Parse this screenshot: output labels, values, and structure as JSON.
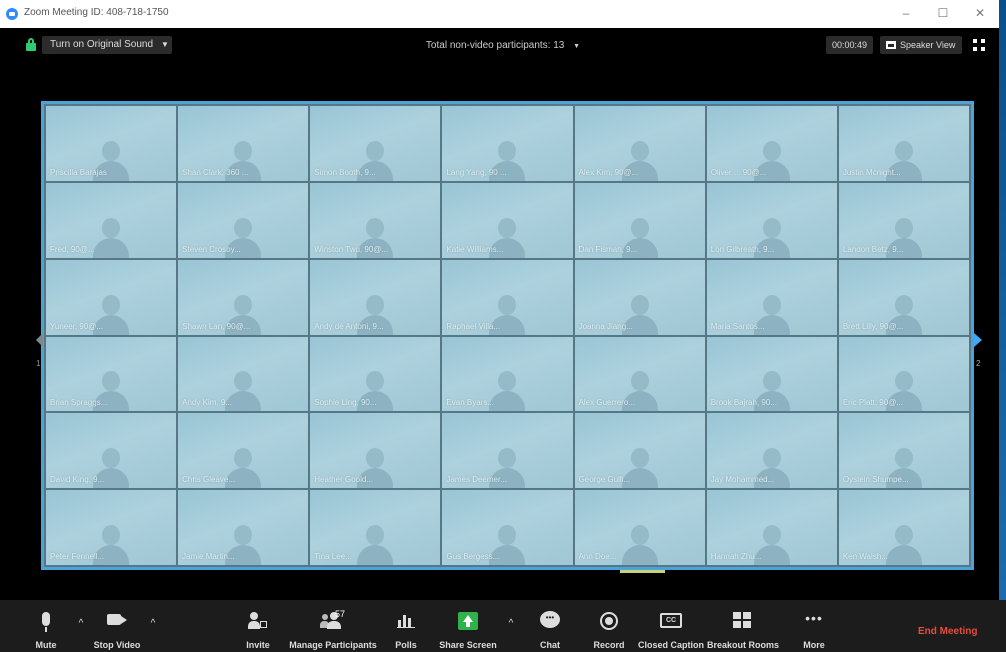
{
  "window": {
    "title": "Zoom Meeting ID: 408-718-1750",
    "minimize": "–",
    "maximize": "☐",
    "close": "✕"
  },
  "topbar": {
    "original_sound_label": "Turn on Original Sound",
    "original_sound_caret": "▼",
    "participants_total": "Total non-video participants: 13",
    "participants_caret": "▼",
    "timer": "00:00:49",
    "speaker_view_label": "Speaker View"
  },
  "gallery": {
    "page_left": "1",
    "page_right": "2",
    "tiles": [
      {
        "name": "Priscilla Barajas"
      },
      {
        "name": "Shan Clark, 360 ..."
      },
      {
        "name": "Simon Booth, 9..."
      },
      {
        "name": "Lang Yang, 90 ..."
      },
      {
        "name": "Alex Kim, 90@..."
      },
      {
        "name": "Oliver ... 90@..."
      },
      {
        "name": "Justin Mcnight..."
      },
      {
        "name": "Fred, 90@..."
      },
      {
        "name": "Steven Crosby..."
      },
      {
        "name": "Winston Twu, 90@..."
      },
      {
        "name": "Katie Williams..."
      },
      {
        "name": "Dan Fisman, 9..."
      },
      {
        "name": "Lon Gilbreath, 9..."
      },
      {
        "name": "Landon Betz, 9..."
      },
      {
        "name": "Yuneer, 90@..."
      },
      {
        "name": "Shawn Lan, 90@..."
      },
      {
        "name": "Andy de Antoni, 9..."
      },
      {
        "name": "Raphael Villa..."
      },
      {
        "name": "Joanna Jiang..."
      },
      {
        "name": "Maria Santos..."
      },
      {
        "name": "Brett Lilly, 90@..."
      },
      {
        "name": "Brian Spraggs..."
      },
      {
        "name": "Andy Kim, 9..."
      },
      {
        "name": "Sophie Ling, 90..."
      },
      {
        "name": "Evan Byars..."
      },
      {
        "name": "Alex Guerrero..."
      },
      {
        "name": "Brook Bajrah, 90..."
      },
      {
        "name": "Eric Platt, 90@..."
      },
      {
        "name": "David King, 9..."
      },
      {
        "name": "Chris Gleave..."
      },
      {
        "name": "Heather Goold..."
      },
      {
        "name": "James Deemer..."
      },
      {
        "name": "George Gulli..."
      },
      {
        "name": "Jay Mohammed..."
      },
      {
        "name": "Oystein Shumpe..."
      },
      {
        "name": "Peter Fennell..."
      },
      {
        "name": "Jamie Martin..."
      },
      {
        "name": "Tina Lee..."
      },
      {
        "name": "Gus Bergess..."
      },
      {
        "name": "Ann Doe..."
      },
      {
        "name": "Hannah Zhu..."
      },
      {
        "name": "Ken Walsh..."
      }
    ]
  },
  "toolbar": {
    "mute": "Mute",
    "stop_video": "Stop Video",
    "invite": "Invite",
    "manage_participants": "Manage Participants",
    "participants_count": "57",
    "polls": "Polls",
    "share_screen": "Share Screen",
    "chat": "Chat",
    "record": "Record",
    "closed_caption": "Closed Caption",
    "cc_glyph": "CC",
    "breakout_rooms": "Breakout Rooms",
    "more": "More",
    "more_glyph": "•••",
    "caret": "^",
    "end_meeting": "End Meeting"
  },
  "colors": {
    "accent_blue": "#2D8CFF",
    "gallery_border": "#4BA3D9",
    "share_green": "#2FB24C",
    "end_red": "#E74C3C",
    "lock_green": "#2ECC71"
  }
}
